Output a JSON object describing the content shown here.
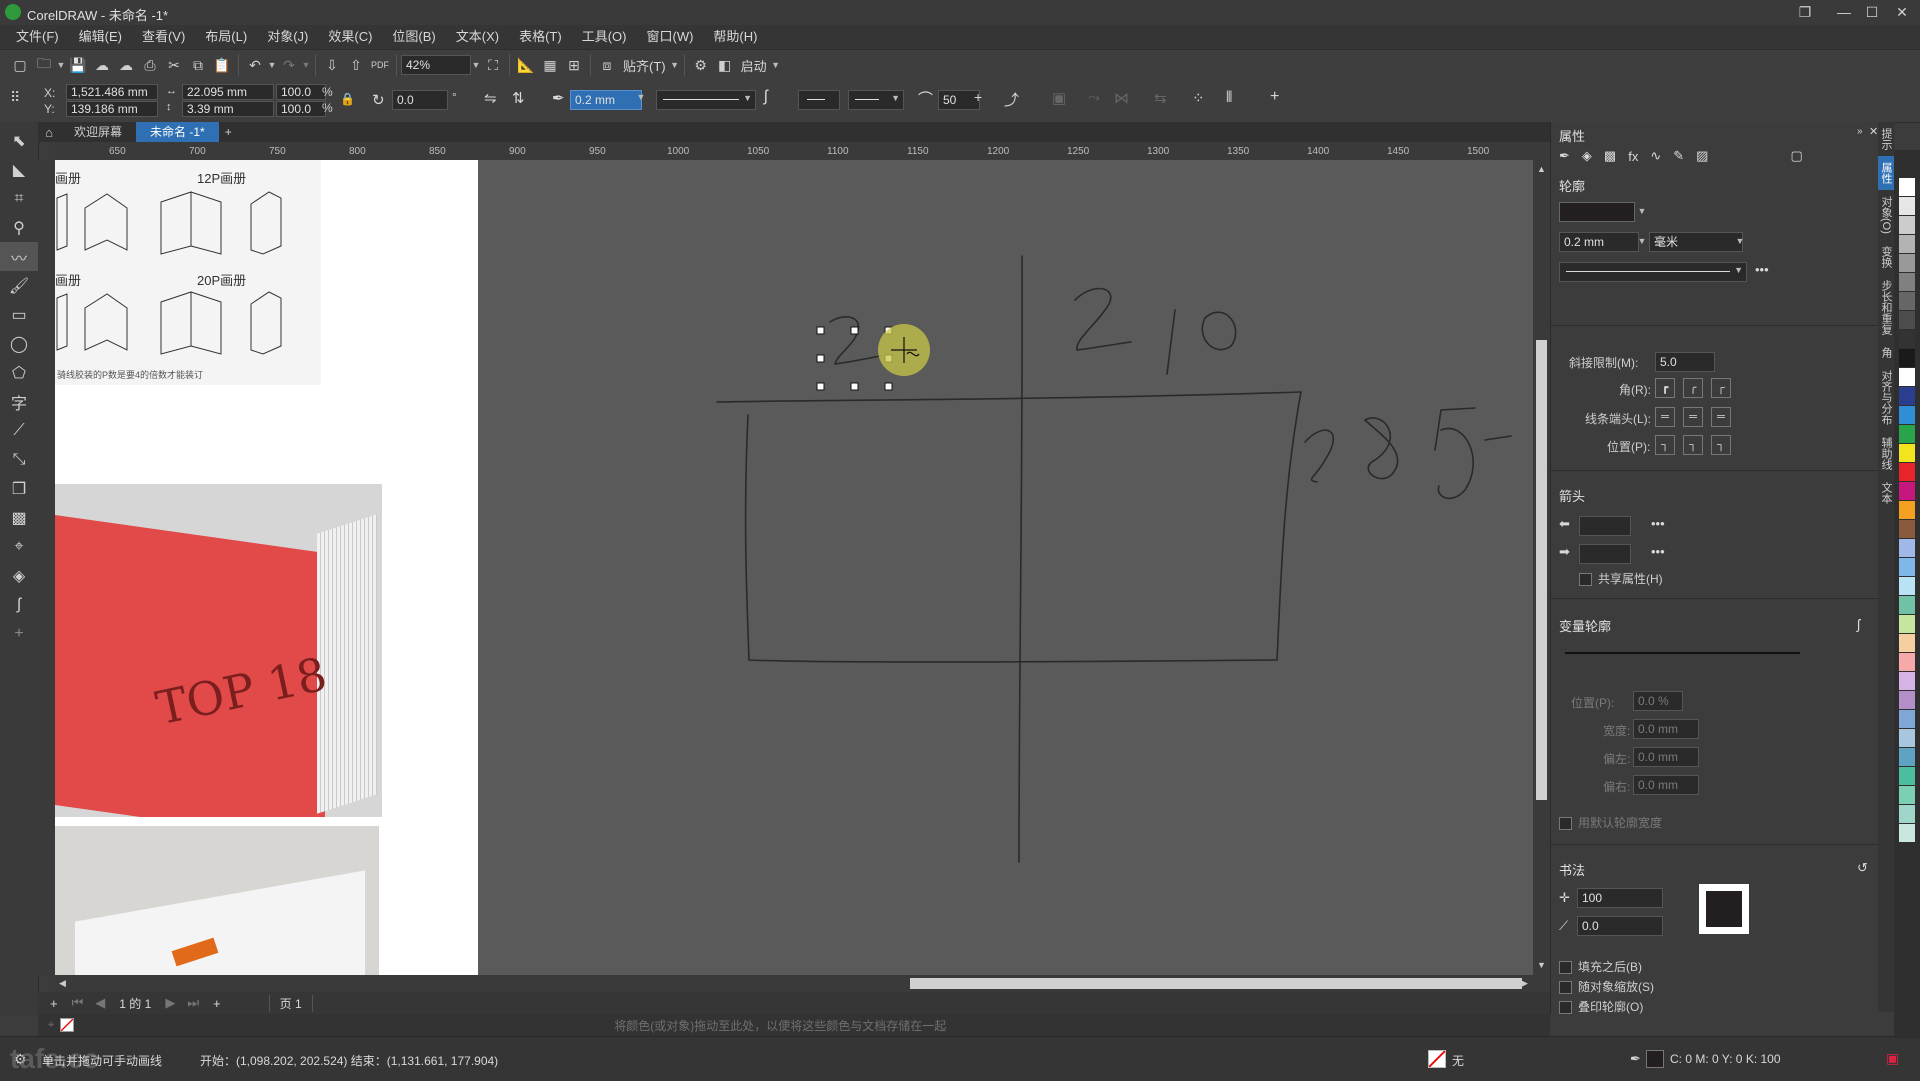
{
  "app": {
    "title": "CorelDRAW - 未命名 -1*"
  },
  "window": {
    "restore": "❐",
    "minimize": "—",
    "maximize": "☐",
    "close": "✕"
  },
  "menu": [
    "文件(F)",
    "编辑(E)",
    "查看(V)",
    "布局(L)",
    "对象(J)",
    "效果(C)",
    "位图(B)",
    "文本(X)",
    "表格(T)",
    "工具(O)",
    "窗口(W)",
    "帮助(H)"
  ],
  "toolbar": {
    "zoom": "42%",
    "snap": "贴齐(T)",
    "launch": "启动"
  },
  "propbar": {
    "x": "1,521.486 mm",
    "y": "139.186 mm",
    "w": "22.095 mm",
    "h": "3.39 mm",
    "sx": "100.0",
    "sy": "100.0",
    "pct": "%",
    "rotation": "0.0",
    "degree": "°",
    "outline_width": "0.2 mm",
    "smoothing": "50",
    "x_label": "X:",
    "y_label": "Y:"
  },
  "tabs": {
    "welcome": "欢迎屏幕",
    "document": "未命名 -1*"
  },
  "ruler": [
    "650",
    "700",
    "750",
    "800",
    "850",
    "900",
    "950",
    "1000",
    "1050",
    "1100",
    "1150",
    "1200",
    "1250",
    "1300",
    "1350",
    "1400",
    "1450",
    "1500"
  ],
  "image_panel": {
    "top_left_label": "画册",
    "top_right_label": "12P画册",
    "mid_left_label": "画册",
    "mid_right_label": "20P画册",
    "note": "骑线胶装的P数是要4的倍数才能装订",
    "book_title": "TOP 18"
  },
  "sketch": {
    "num1": "210",
    "num2": "285",
    "num_small": "2"
  },
  "pagenav": {
    "counter": "1 的 1",
    "page_tab": "页 1"
  },
  "docker_hint": "将颜色(或对象)拖动至此处，以便将这些颜色与文档存储在一起",
  "status": {
    "hint": "单击并拖动可手动画线",
    "coords": "开始：(1,098.202, 202.524)  结束：(1,131.661, 177.904)",
    "fill": "无",
    "color_model": "C: 0 M: 0 Y: 0 K: 100",
    "watermark": "tafe.cc"
  },
  "props": {
    "header": "属性",
    "outline": "轮廓",
    "width": "0.2 mm",
    "unit": "毫米",
    "miter_label": "斜接限制(M):",
    "miter_value": "5.0",
    "corner_label": "角(R):",
    "caps_label": "线条端头(L):",
    "position_label": "位置(P):",
    "arrows": "箭头",
    "share_attr": "共享属性(H)",
    "variable_outline": "变量轮廓",
    "var_position_label": "位置(P):",
    "var_position_value": "0.0 %",
    "var_width_label": "宽度:",
    "var_width_value": "0.0 mm",
    "var_left_label": "偏左:",
    "var_left_value": "0.0 mm",
    "var_right_label": "偏右:",
    "var_right_value": "0.0 mm",
    "use_default": "用默认轮廓宽度",
    "calligraphy": "书法",
    "stretch": "100",
    "angle": "0.0",
    "fill_behind": "填充之后(B)",
    "scale_with_object": "随对象缩放(S)",
    "overprint": "叠印轮廓(O)",
    "more": "•••"
  },
  "docker_tabs": [
    "提示",
    "属性",
    "对象(O)",
    "变换",
    "步长和重复",
    "角",
    "对齐与分布",
    "辅助线",
    "文本"
  ],
  "palette": [
    "#ffffff",
    "#e6e6e6",
    "#cccccc",
    "#b3b3b3",
    "#999999",
    "#808080",
    "#666666",
    "#4d4d4d",
    "#333333",
    "#1a1a1a",
    "#ffffff",
    "#2b3d8f",
    "#2f8fd6",
    "#2aa44a",
    "#f2e51e",
    "#e8232a",
    "#c7177e",
    "#f4a021",
    "#8a5a3c",
    "#9fb8e8",
    "#7fb8e8",
    "#b9e3f5",
    "#6fc2a6",
    "#c6e6a0",
    "#f5cfa0",
    "#f6a9a9",
    "#d6b3e6",
    "#b38ec7",
    "#7fa7d4",
    "#a8c6de",
    "#5fa3c3",
    "#4bbf9d",
    "#7bd0b4",
    "#9ed7c9",
    "#c8e8df"
  ],
  "colors": {
    "accent": "#2f6fb3",
    "canvas": "#5a5a5a",
    "page": "#ffffff",
    "selection_dot": "#c8c84a"
  }
}
